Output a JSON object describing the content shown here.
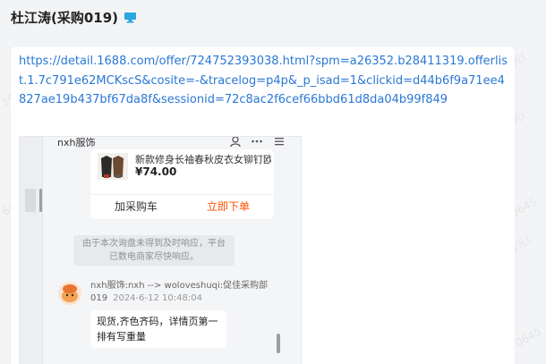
{
  "header": {
    "title": "杜江涛(采购019)",
    "icon": "monitor-icon",
    "icon_color": "#2aa6e0"
  },
  "message": {
    "link_text": "https://detail.1688.com/offer/724752393038.html?spm=a26352.b28411319.offerlist.1.7c791e62MCKscS&cosite=-&tracelog=p4p&_p_isad=1&clickid=d44b6f9a71ee4827ae19b437bf67da8f&sessionid=72c8ac2f6cef66bbd61d8da04b99f849",
    "link_color": "#2a78d6"
  },
  "screenshot": {
    "shop_name": "nxh服饰",
    "top_icons": [
      "user-icon",
      "more-icon",
      "menu-icon"
    ],
    "product": {
      "title": "新款修身长袖春秋皮衣女铆钉欧美",
      "price": "¥74.00",
      "add_cart_label": "加采购车",
      "buy_now_label": "立即下单",
      "buy_color": "#ff5000"
    },
    "system_notice": "由于本次询盘未得到及时响应，平台已数电商家尽快响应。",
    "reply": {
      "sender": "nxh服饰:nxh --> woloveshuqi:促佳采购部019",
      "time": "2024-6-12 10:48:04",
      "text": "现货,齐色齐码，详情页第一排有写重量"
    }
  }
}
